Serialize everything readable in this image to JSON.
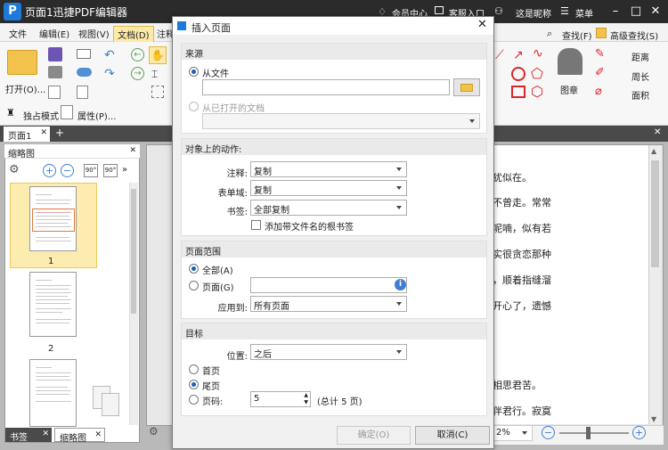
{
  "app": {
    "title": "页面1迅捷PDF编辑器",
    "logo_letter": "P",
    "member_center": "会员中心",
    "customer_service": "客服入口",
    "user": "这是昵称",
    "menu": "菜单"
  },
  "menubar": [
    "文件",
    "编辑(E)",
    "视图(V)",
    "文档(D)",
    "注释"
  ],
  "ribbon": {
    "open": "打开(O)...",
    "exclusive_mode": "独占模式",
    "properties": "属性(P)...",
    "find": "查找(F)",
    "advanced_find": "高级查找(S)",
    "stamp": "图章",
    "distance": "距离",
    "perimeter": "周长",
    "area": "面积"
  },
  "doctabs": {
    "page1": "页面1",
    "add": "+"
  },
  "thumbpanel": {
    "title": "缩略图",
    "pages": [
      "1",
      "2"
    ]
  },
  "bottomtabs": {
    "bookmark": "书签",
    "thumbnail": "缩略图"
  },
  "document": {
    "lines": [
      "犹似在。",
      "不曾走。常常",
      "呢喃，似有若",
      "实很贪恋那种",
      "，顺着指缝溜",
      "开心了，遗憾",
      "相思君苦。",
      "伴君行。寂寞"
    ]
  },
  "status": {
    "zoom": "2%"
  },
  "dialog": {
    "title": "插入页面",
    "source": {
      "heading": "来源",
      "from_file": "从文件",
      "file_value": "",
      "from_open_doc": "从已打开的文档",
      "open_doc_value": ""
    },
    "actions": {
      "heading": "对象上的动作:",
      "annotation_label": "注释:",
      "annotation_value": "复制",
      "form_label": "表单域:",
      "form_value": "复制",
      "bookmark_label": "书签:",
      "bookmark_value": "全部复制",
      "add_root_bookmark": "添加带文件名的根书签"
    },
    "range": {
      "heading": "页面范围",
      "all": "全部(A)",
      "pages": "页面(G)",
      "pages_value": "",
      "apply_label": "应用到:",
      "apply_value": "所有页面"
    },
    "target": {
      "heading": "目标",
      "position_label": "位置:",
      "position_value": "之后",
      "first": "首页",
      "last": "尾页",
      "page_no": "页码:",
      "page_value": "5",
      "total": "(总计 5 页)"
    },
    "ok": "确定(O)",
    "cancel": "取消(C)"
  }
}
